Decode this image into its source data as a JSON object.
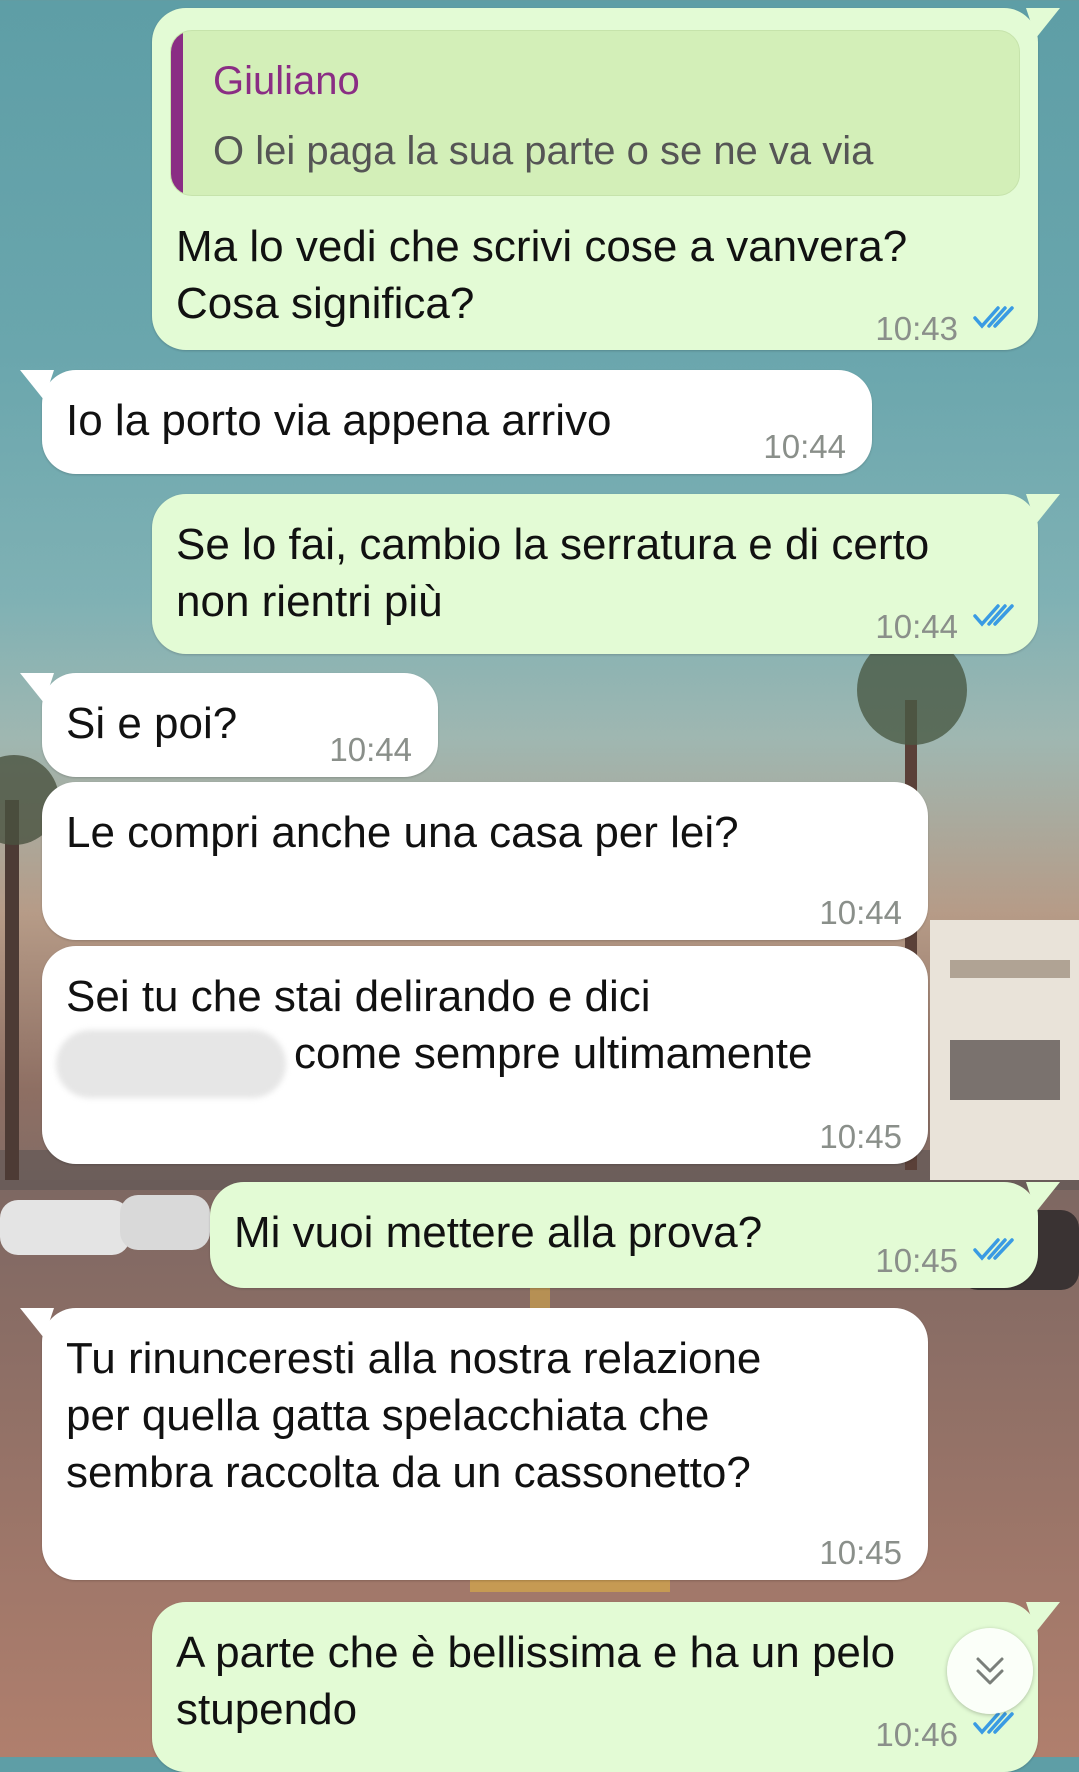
{
  "colors": {
    "outgoing_bubble": "#e3fbd5",
    "incoming_bubble": "#ffffff",
    "quote_accent": "#8a2d84",
    "read_ticks": "#3a9be3",
    "timestamp": "#8a8f8a"
  },
  "messages": [
    {
      "direction": "outgoing",
      "quote": {
        "author": "Giuliano",
        "text": "O lei paga la sua parte o se ne va via"
      },
      "lines": [
        "Ma lo vedi che scrivi cose a vanvera?",
        "Cosa significa?"
      ],
      "time": "10:43",
      "status_icon": "double-check-read-icon"
    },
    {
      "direction": "incoming",
      "lines": [
        "Io la porto via appena arrivo"
      ],
      "time": "10:44"
    },
    {
      "direction": "outgoing",
      "lines": [
        "Se lo fai, cambio la serratura e di certo",
        "non rientri più"
      ],
      "time": "10:44",
      "status_icon": "double-check-read-icon"
    },
    {
      "direction": "incoming",
      "lines": [
        "Si e poi?"
      ],
      "time": "10:44"
    },
    {
      "direction": "incoming",
      "lines": [
        "Le compri anche una casa per lei?"
      ],
      "time": "10:44"
    },
    {
      "direction": "incoming",
      "lines": [
        "Sei tu che stai delirando e dici",
        "come sempre ultimamente"
      ],
      "time": "10:45"
    },
    {
      "direction": "outgoing",
      "lines": [
        "Mi vuoi mettere alla prova?"
      ],
      "time": "10:45",
      "status_icon": "double-check-read-icon"
    },
    {
      "direction": "incoming",
      "lines": [
        "Tu rinunceresti alla nostra relazione",
        "per quella gatta spelacchiata che",
        "sembra raccolta da un cassonetto?"
      ],
      "time": "10:45"
    },
    {
      "direction": "outgoing",
      "lines": [
        "A parte che è bellissima e ha un pelo",
        "stupendo"
      ],
      "time": "10:46",
      "status_icon": "double-check-read-icon"
    }
  ],
  "scroll_button": {
    "icon": "double-chevron-down-icon"
  }
}
